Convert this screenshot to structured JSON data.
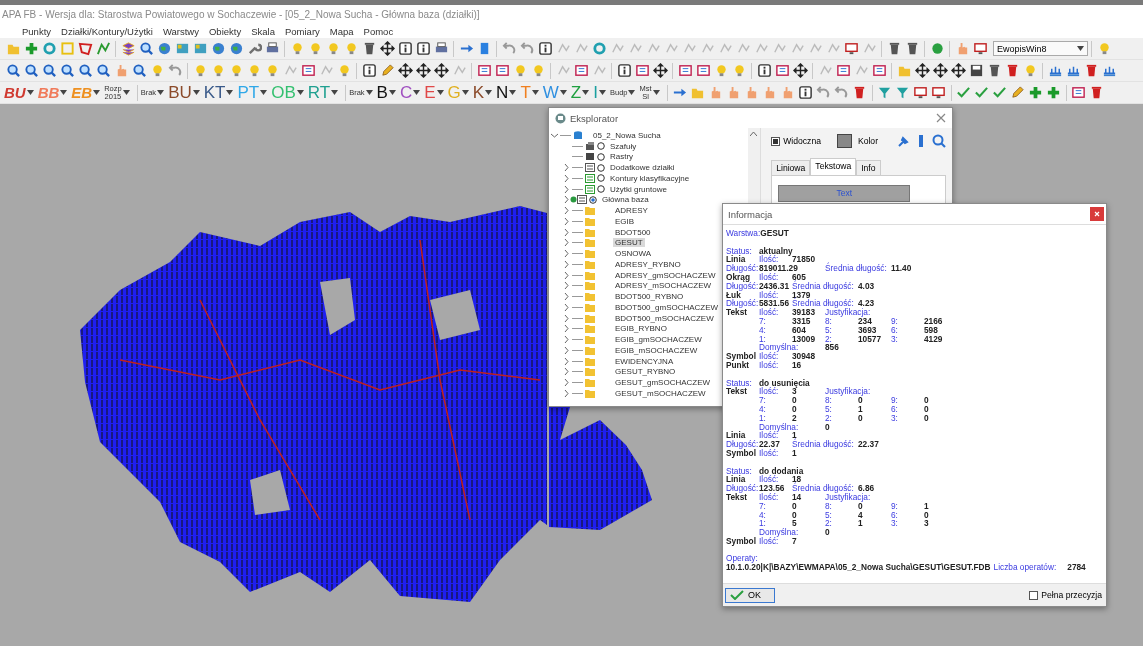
{
  "window": {
    "title": "APA FB - Wersja dla: Starostwa Powiatowego w Sochaczewie - [05_2_Nowa Sucha - Główna baza (działki)]"
  },
  "menu": [
    "Punkty",
    "Działki/Kontury/Użytki",
    "Warstwy",
    "Obiekty",
    "Skala",
    "Pomiary",
    "Mapa",
    "Pomoc"
  ],
  "toolbar": {
    "combo": "EwopisWin8"
  },
  "letter_bar": [
    {
      "kind": "italic",
      "label": "BU",
      "color": "#d03a30"
    },
    {
      "kind": "italic",
      "label": "BB",
      "color": "#f07a5a"
    },
    {
      "kind": "italic",
      "label": "EB",
      "color": "#ee9020"
    },
    {
      "kind": "small",
      "lines": [
        "Rozp",
        "2015"
      ]
    },
    {
      "kind": "gap"
    },
    {
      "kind": "small",
      "lines": [
        "Brak"
      ]
    },
    {
      "kind": "big",
      "label": "BU",
      "color": "#8b4a2a"
    },
    {
      "kind": "big",
      "label": "KT",
      "color": "#3a5a8a"
    },
    {
      "kind": "big",
      "label": "PT",
      "color": "#30a8e8"
    },
    {
      "kind": "big",
      "label": "OB",
      "color": "#34c070"
    },
    {
      "kind": "big",
      "label": "RT",
      "color": "#20a090"
    },
    {
      "kind": "gap"
    },
    {
      "kind": "small",
      "lines": [
        "Brak"
      ]
    },
    {
      "kind": "big",
      "label": "B",
      "color": "#111111"
    },
    {
      "kind": "big",
      "label": "C",
      "color": "#a050c0"
    },
    {
      "kind": "big",
      "label": "E",
      "color": "#e04848"
    },
    {
      "kind": "big",
      "label": "G",
      "color": "#e0b020"
    },
    {
      "kind": "big",
      "label": "K",
      "color": "#8b4a2a"
    },
    {
      "kind": "big",
      "label": "N",
      "color": "#111111"
    },
    {
      "kind": "big",
      "label": "T",
      "color": "#f08020"
    },
    {
      "kind": "big",
      "label": "W",
      "color": "#3090e0"
    },
    {
      "kind": "big",
      "label": "Z",
      "color": "#20a040"
    },
    {
      "kind": "big",
      "label": "I",
      "color": "#1aa0a0"
    },
    {
      "kind": "small",
      "lines": [
        "Budp"
      ]
    },
    {
      "kind": "small",
      "lines": [
        "Mst",
        "Sl"
      ]
    }
  ],
  "explorer": {
    "title": "Eksplorator",
    "tree": {
      "label": "05_2_Nowa Sucha",
      "expanded": true,
      "children": [
        {
          "label": "Szafuły",
          "kind": "group",
          "on": false,
          "selected": false
        },
        {
          "label": "Rastry",
          "kind": "raster",
          "on": false,
          "selected": false
        },
        {
          "label": "Dodatkowe działki",
          "kind": "layer",
          "on": false,
          "expanded": false,
          "selected": false
        },
        {
          "label": "Kontury klasyfikacyjne",
          "kind": "green-layer",
          "on": false,
          "expanded": false,
          "selected": false
        },
        {
          "label": "Użytki gruntowe",
          "kind": "green-layer",
          "on": false,
          "expanded": false,
          "selected": false
        },
        {
          "label": "Główna baza",
          "kind": "layer",
          "on": true,
          "expanded": false,
          "selected": false
        },
        {
          "label": "ADRESY",
          "kind": "folder",
          "expanded": false,
          "selected": false
        },
        {
          "label": "EGIB",
          "kind": "folder",
          "expanded": false,
          "selected": false
        },
        {
          "label": "BDOT500",
          "kind": "folder",
          "expanded": false,
          "selected": false
        },
        {
          "label": "GESUT",
          "kind": "folder",
          "expanded": false,
          "selected": true
        },
        {
          "label": "OSNOWA",
          "kind": "folder",
          "expanded": false,
          "selected": false
        },
        {
          "label": "ADRESY_RYBNO",
          "kind": "folder",
          "expanded": false,
          "selected": false
        },
        {
          "label": "ADRESY_gmSOCHACZEW",
          "kind": "folder",
          "expanded": false,
          "selected": false
        },
        {
          "label": "ADRESY_mSOCHACZEW",
          "kind": "folder",
          "expanded": false,
          "selected": false
        },
        {
          "label": "BDOT500_RYBNO",
          "kind": "folder",
          "expanded": false,
          "selected": false
        },
        {
          "label": "BDOT500_gmSOCHACZEW",
          "kind": "folder",
          "expanded": false,
          "selected": false
        },
        {
          "label": "BDOT500_mSOCHACZEW",
          "kind": "folder",
          "expanded": false,
          "selected": false
        },
        {
          "label": "EGIB_RYBNO",
          "kind": "folder",
          "expanded": false,
          "selected": false
        },
        {
          "label": "EGIB_gmSOCHACZEW",
          "kind": "folder",
          "expanded": false,
          "selected": false
        },
        {
          "label": "EGIB_mSOCHACZEW",
          "kind": "folder",
          "expanded": false,
          "selected": false
        },
        {
          "label": "EWIDENCYJNA",
          "kind": "folder",
          "expanded": false,
          "selected": false
        },
        {
          "label": "GESUT_RYBNO",
          "kind": "folder",
          "expanded": false,
          "selected": false
        },
        {
          "label": "GESUT_gmSOCHACZEW",
          "kind": "folder",
          "expanded": false,
          "selected": false
        },
        {
          "label": "GESUT_mSOCHACZEW",
          "kind": "folder",
          "expanded": false,
          "selected": false
        }
      ]
    },
    "visible": {
      "label": "Widoczna",
      "checked": true
    },
    "color_label": "Kolor",
    "tabs": [
      {
        "label": "Liniowa",
        "selected": false
      },
      {
        "label": "Tekstowa",
        "selected": true
      },
      {
        "label": "Info",
        "selected": false
      }
    ],
    "text_button": "Text"
  },
  "info": {
    "title": "Informacja",
    "layer_label": "Warstwa:",
    "layer": "GESUT",
    "sections": [
      {
        "rows": [
          [
            {
              "kind": "tag",
              "text": "Status:"
            },
            {
              "kind": "value",
              "text": "aktualny"
            }
          ],
          [
            {
              "kind": "name",
              "text": "Linia"
            },
            {
              "kind": "key",
              "text": "Ilość:"
            },
            {
              "kind": "value",
              "text": "71850"
            }
          ],
          [
            {
              "kind": "tag",
              "text": "Długość:"
            },
            {
              "kind": "value",
              "text": "819011.29"
            },
            "",
            {
              "kind": "key",
              "text": "Średnia długość:"
            },
            "",
            {
              "kind": "value",
              "text": "11.40"
            }
          ],
          [
            {
              "kind": "name",
              "text": "Okrąg"
            },
            {
              "kind": "key",
              "text": "Ilość:"
            },
            {
              "kind": "value",
              "text": "605"
            }
          ],
          [
            {
              "kind": "tag",
              "text": "Długość:"
            },
            {
              "kind": "value",
              "text": "2436.31"
            },
            {
              "kind": "key",
              "text": "Średnia długość:"
            },
            "",
            {
              "kind": "value",
              "text": "4.03"
            }
          ],
          [
            {
              "kind": "name",
              "text": "Łuk"
            },
            {
              "kind": "key",
              "text": "Ilość:"
            },
            {
              "kind": "value",
              "text": "1379"
            }
          ],
          [
            {
              "kind": "tag",
              "text": "Długość:"
            },
            {
              "kind": "value",
              "text": "5831.56"
            },
            {
              "kind": "key",
              "text": "Średnia długość:"
            },
            "",
            {
              "kind": "value",
              "text": "4.23"
            }
          ],
          [
            {
              "kind": "name",
              "text": "Tekst"
            },
            {
              "kind": "key",
              "text": "Ilość:"
            },
            {
              "kind": "value",
              "text": "39183"
            },
            {
              "kind": "key",
              "text": "Justyfikacja:"
            }
          ],
          [
            "",
            {
              "kind": "key",
              "text": "7:"
            },
            {
              "kind": "value",
              "text": "3315"
            },
            {
              "kind": "key",
              "text": "8:"
            },
            {
              "kind": "value",
              "text": "234"
            },
            {
              "kind": "key",
              "text": "9:"
            },
            {
              "kind": "value",
              "text": "2166"
            }
          ],
          [
            "",
            {
              "kind": "key",
              "text": "4:"
            },
            {
              "kind": "value",
              "text": "604"
            },
            {
              "kind": "key",
              "text": "5:"
            },
            {
              "kind": "value",
              "text": "3693"
            },
            {
              "kind": "key",
              "text": "6:"
            },
            {
              "kind": "value",
              "text": "598"
            }
          ],
          [
            "",
            {
              "kind": "key",
              "text": "1:"
            },
            {
              "kind": "value",
              "text": "13009"
            },
            {
              "kind": "key",
              "text": "2:"
            },
            {
              "kind": "value",
              "text": "10577"
            },
            {
              "kind": "key",
              "text": "3:"
            },
            {
              "kind": "value",
              "text": "4129"
            }
          ],
          [
            "",
            {
              "kind": "key",
              "text": "Domyślna:"
            },
            "",
            {
              "kind": "value",
              "text": "856"
            }
          ],
          [
            {
              "kind": "name",
              "text": "Symbol"
            },
            {
              "kind": "key",
              "text": "Ilość:"
            },
            {
              "kind": "value",
              "text": "30948"
            }
          ],
          [
            {
              "kind": "name",
              "text": "Punkt"
            },
            {
              "kind": "key",
              "text": "Ilość:"
            },
            {
              "kind": "value",
              "text": "16"
            }
          ]
        ]
      },
      {
        "rows": [
          [
            {
              "kind": "tag",
              "text": "Status:"
            },
            {
              "kind": "value",
              "text": "do usunięcia"
            }
          ],
          [
            {
              "kind": "name",
              "text": "Tekst"
            },
            {
              "kind": "key",
              "text": "Ilość:"
            },
            {
              "kind": "value",
              "text": "3"
            },
            {
              "kind": "key",
              "text": "Justyfikacja:"
            }
          ],
          [
            "",
            {
              "kind": "key",
              "text": "7:"
            },
            {
              "kind": "value",
              "text": "0"
            },
            {
              "kind": "key",
              "text": "8:"
            },
            {
              "kind": "value",
              "text": "0"
            },
            {
              "kind": "key",
              "text": "9:"
            },
            {
              "kind": "value",
              "text": "0"
            }
          ],
          [
            "",
            {
              "kind": "key",
              "text": "4:"
            },
            {
              "kind": "value",
              "text": "0"
            },
            {
              "kind": "key",
              "text": "5:"
            },
            {
              "kind": "value",
              "text": "1"
            },
            {
              "kind": "key",
              "text": "6:"
            },
            {
              "kind": "value",
              "text": "0"
            }
          ],
          [
            "",
            {
              "kind": "key",
              "text": "1:"
            },
            {
              "kind": "value",
              "text": "2"
            },
            {
              "kind": "key",
              "text": "2:"
            },
            {
              "kind": "value",
              "text": "0"
            },
            {
              "kind": "key",
              "text": "3:"
            },
            {
              "kind": "value",
              "text": "0"
            }
          ],
          [
            "",
            {
              "kind": "key",
              "text": "Domyślna:"
            },
            "",
            {
              "kind": "value",
              "text": "0"
            }
          ],
          [
            {
              "kind": "name",
              "text": "Linia"
            },
            {
              "kind": "key",
              "text": "Ilość:"
            },
            {
              "kind": "value",
              "text": "1"
            }
          ],
          [
            {
              "kind": "tag",
              "text": "Długość:"
            },
            {
              "kind": "value",
              "text": "22.37"
            },
            {
              "kind": "key",
              "text": "Średnia długość:"
            },
            "",
            {
              "kind": "value",
              "text": "22.37"
            }
          ],
          [
            {
              "kind": "name",
              "text": "Symbol"
            },
            {
              "kind": "key",
              "text": "Ilość:"
            },
            {
              "kind": "value",
              "text": "1"
            }
          ]
        ]
      },
      {
        "rows": [
          [
            {
              "kind": "tag",
              "text": "Status:"
            },
            {
              "kind": "value",
              "text": "do dodania"
            }
          ],
          [
            {
              "kind": "name",
              "text": "Linia"
            },
            {
              "kind": "key",
              "text": "Ilość:"
            },
            {
              "kind": "value",
              "text": "18"
            }
          ],
          [
            {
              "kind": "tag",
              "text": "Długość:"
            },
            {
              "kind": "value",
              "text": "123.56"
            },
            {
              "kind": "key",
              "text": "Średnia długość:"
            },
            "",
            {
              "kind": "value",
              "text": "6.86"
            }
          ],
          [
            {
              "kind": "name",
              "text": "Tekst"
            },
            {
              "kind": "key",
              "text": "Ilość:"
            },
            {
              "kind": "value",
              "text": "14"
            },
            {
              "kind": "key",
              "text": "Justyfikacja:"
            }
          ],
          [
            "",
            {
              "kind": "key",
              "text": "7:"
            },
            {
              "kind": "value",
              "text": "0"
            },
            {
              "kind": "key",
              "text": "8:"
            },
            {
              "kind": "value",
              "text": "0"
            },
            {
              "kind": "key",
              "text": "9:"
            },
            {
              "kind": "value",
              "text": "1"
            }
          ],
          [
            "",
            {
              "kind": "key",
              "text": "4:"
            },
            {
              "kind": "value",
              "text": "0"
            },
            {
              "kind": "key",
              "text": "5:"
            },
            {
              "kind": "value",
              "text": "4"
            },
            {
              "kind": "key",
              "text": "6:"
            },
            {
              "kind": "value",
              "text": "0"
            }
          ],
          [
            "",
            {
              "kind": "key",
              "text": "1:"
            },
            {
              "kind": "value",
              "text": "5"
            },
            {
              "kind": "key",
              "text": "2:"
            },
            {
              "kind": "value",
              "text": "1"
            },
            {
              "kind": "key",
              "text": "3:"
            },
            {
              "kind": "value",
              "text": "3"
            }
          ],
          [
            "",
            {
              "kind": "key",
              "text": "Domyślna:"
            },
            "",
            {
              "kind": "value",
              "text": "0"
            }
          ],
          [
            {
              "kind": "name",
              "text": "Symbol"
            },
            {
              "kind": "key",
              "text": "Ilość:"
            },
            {
              "kind": "value",
              "text": "7"
            }
          ]
        ]
      }
    ],
    "operaty_label": "Operaty:",
    "operaty_path": "10.1.0.20|K|\\BAZY\\EWMAPA\\05_2_Nowa Sucha\\GESUT\\GESUT.FDB",
    "count_label": "Liczba operatów:",
    "count": "2784",
    "ok": "OK",
    "full_precision": {
      "label": "Pełna przecyzja",
      "checked": false
    }
  }
}
